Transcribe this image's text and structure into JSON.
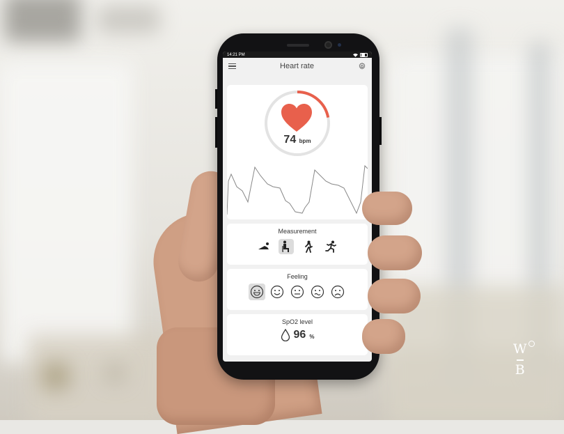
{
  "statusbar": {
    "time": "14:21 PM"
  },
  "appbar": {
    "title": "Heart rate",
    "menu_icon": "hamburger-icon",
    "settings_icon": "gear-icon"
  },
  "heart": {
    "value": "74",
    "unit": "bpm",
    "accent": "#e8604c",
    "ring_progress": 0.22
  },
  "measurement": {
    "title": "Measurement",
    "options": [
      "lying-icon",
      "sitting-icon",
      "walking-icon",
      "running-icon"
    ],
    "selected_index": 1
  },
  "feeling": {
    "title": "Feeling",
    "options": [
      "very-happy-face-icon",
      "happy-face-icon",
      "neutral-face-icon",
      "sad-face-icon",
      "very-sad-face-icon"
    ],
    "selected_index": 0
  },
  "spo2": {
    "title": "SpO2 level",
    "value": "96",
    "unit": "%",
    "icon": "drop-icon"
  },
  "logo": {
    "text_top": "W",
    "text_bottom": "B"
  }
}
